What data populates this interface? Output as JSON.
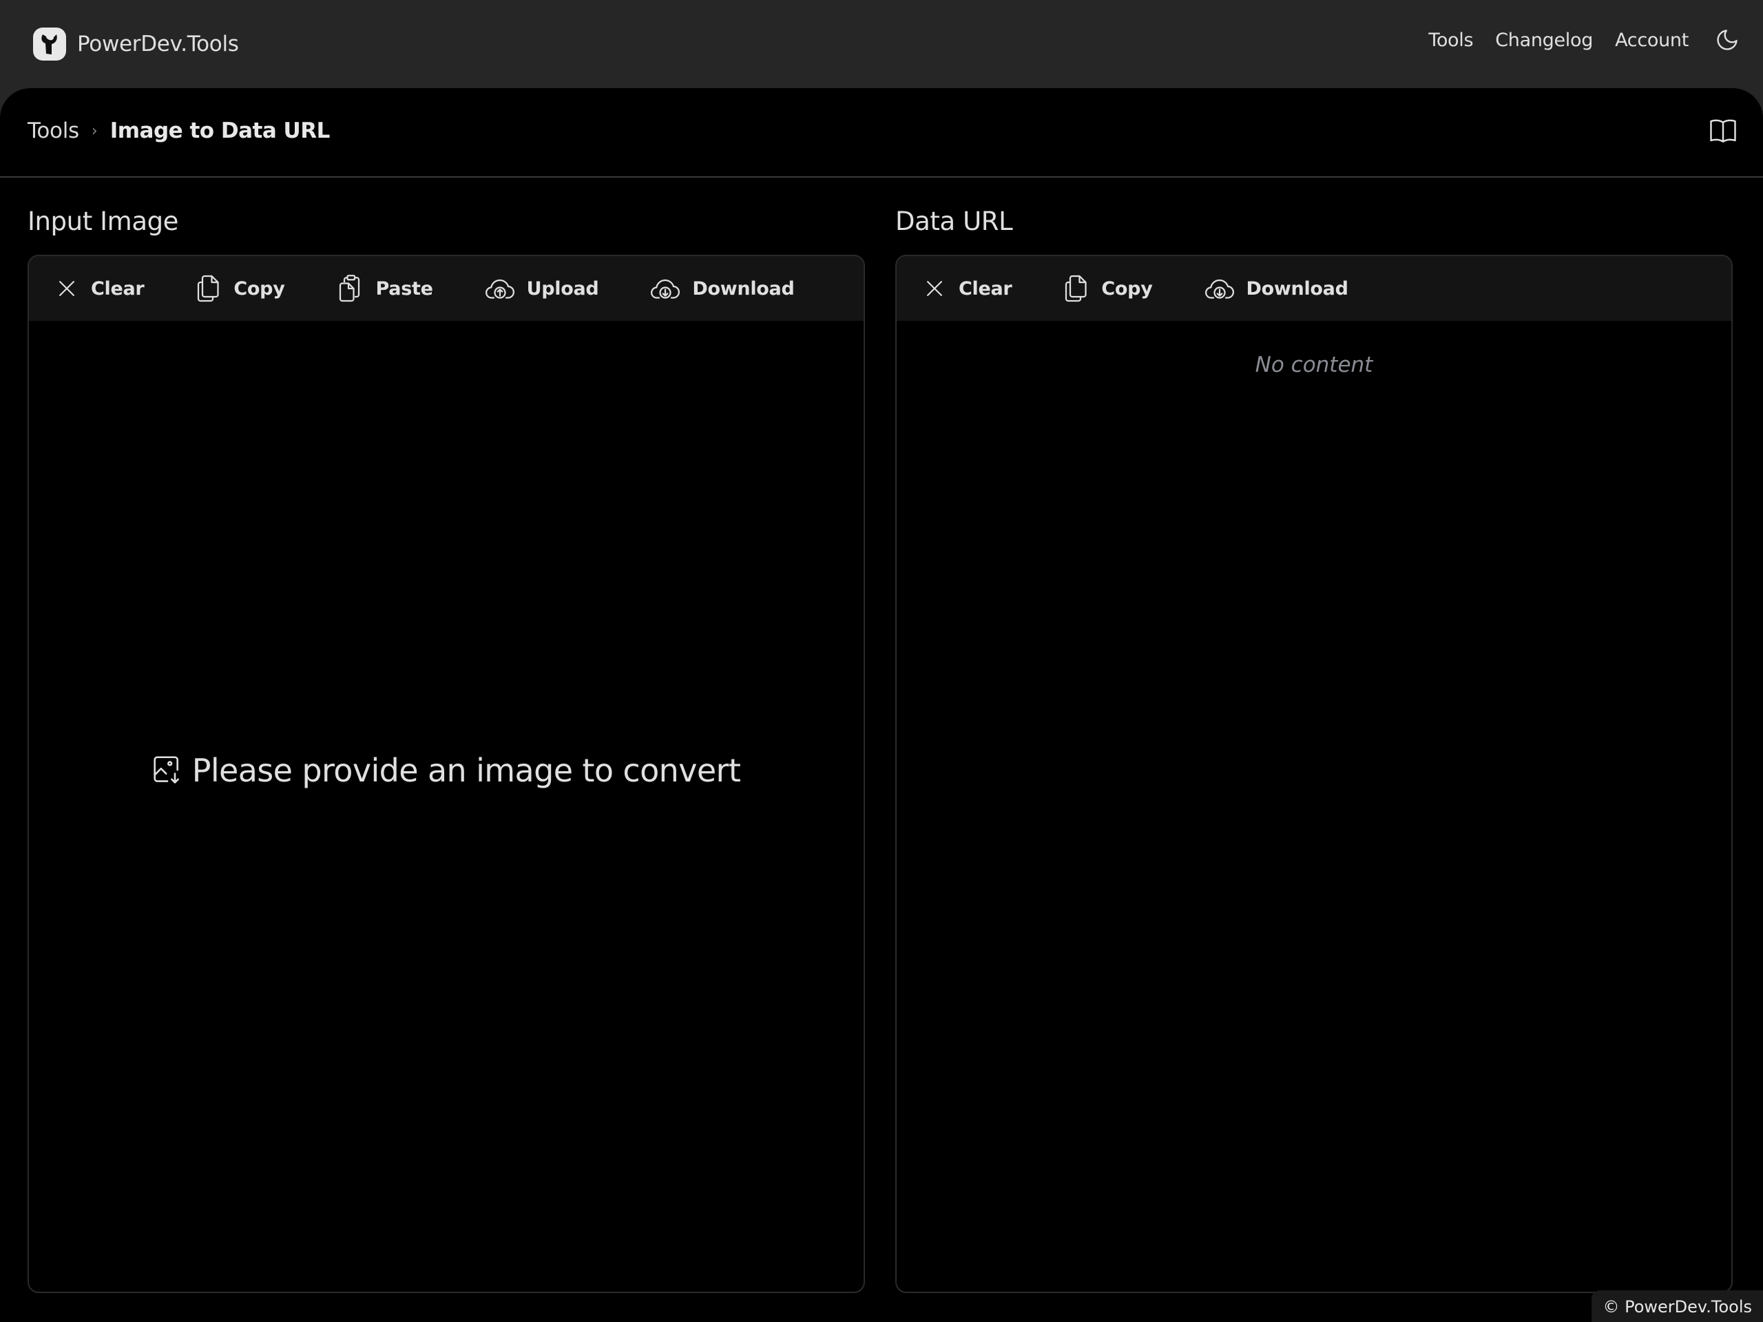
{
  "header": {
    "brand_name": "PowerDev.Tools",
    "nav": [
      {
        "label": "Tools"
      },
      {
        "label": "Changelog"
      },
      {
        "label": "Account"
      }
    ],
    "theme_icon": "moon-icon"
  },
  "breadcrumb": {
    "root": "Tools",
    "separator": "›",
    "current": "Image to Data URL",
    "docs_icon": "book-open-icon"
  },
  "input_panel": {
    "title": "Input Image",
    "toolbar": [
      {
        "label": "Clear",
        "icon": "x-icon"
      },
      {
        "label": "Copy",
        "icon": "copy-icon"
      },
      {
        "label": "Paste",
        "icon": "clipboard-paste-icon"
      },
      {
        "label": "Upload",
        "icon": "cloud-upload-icon"
      },
      {
        "label": "Download",
        "icon": "cloud-download-icon"
      }
    ],
    "placeholder": "Please provide an image to convert",
    "placeholder_icon": "image-import-icon"
  },
  "output_panel": {
    "title": "Data URL",
    "toolbar": [
      {
        "label": "Clear",
        "icon": "x-icon"
      },
      {
        "label": "Copy",
        "icon": "copy-icon"
      },
      {
        "label": "Download",
        "icon": "cloud-download-icon"
      }
    ],
    "empty_text": "No content"
  },
  "footer": {
    "text": "© PowerDev.Tools"
  },
  "colors": {
    "header_bg": "#262626",
    "main_bg": "#000000",
    "toolbar_bg": "#141414",
    "text": "#e0e0e0",
    "muted": "#8a8d94"
  }
}
